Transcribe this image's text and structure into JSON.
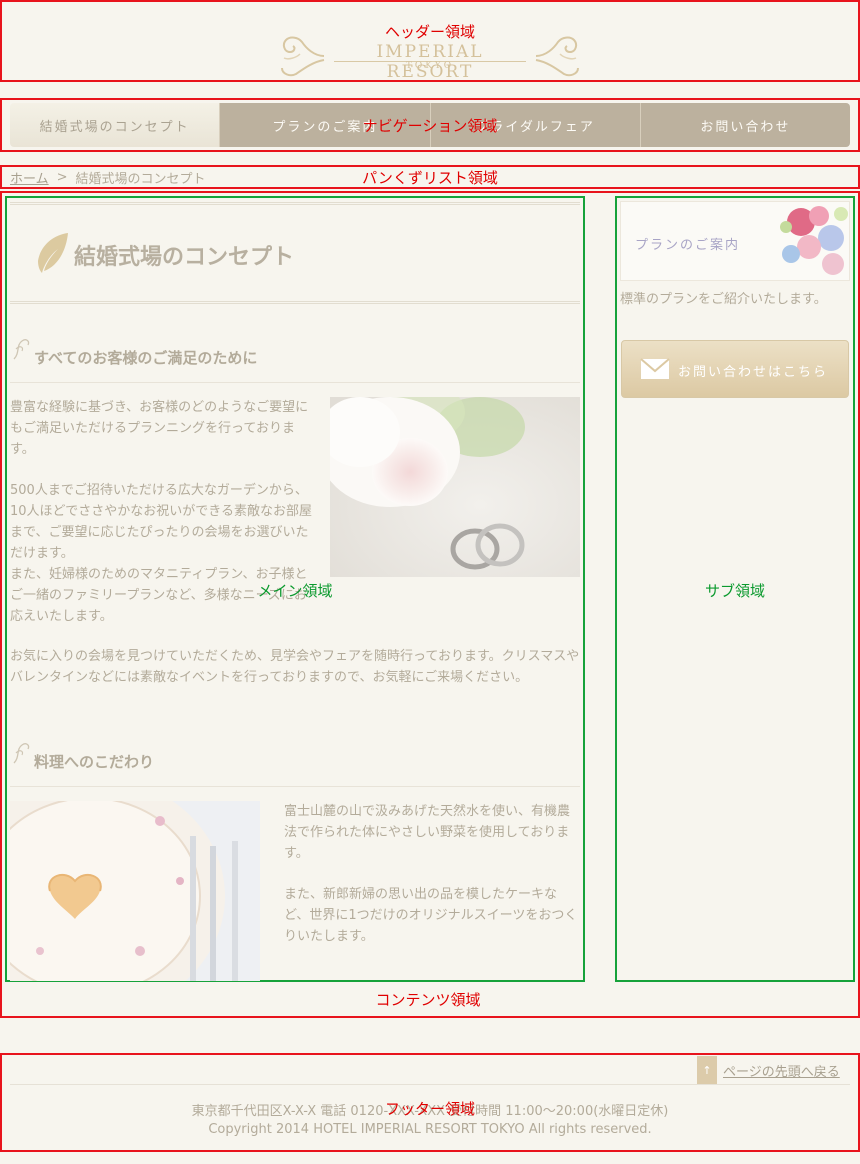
{
  "regions": {
    "header": "ヘッダー領域",
    "nav": "ナビゲーション領域",
    "breadcrumb": "パンくずリスト領域",
    "main": "メイン領域",
    "sub": "サブ領域",
    "contents": "コンテンツ領域",
    "footer": "フッター領域"
  },
  "header": {
    "logo_main": "IMPERIAL RESORT",
    "logo_sub": "TOKYO"
  },
  "nav": {
    "items": [
      {
        "label": "結婚式場のコンセプト",
        "active": true
      },
      {
        "label": "プランのご案内",
        "active": false
      },
      {
        "label": "ブライダルフェア",
        "active": false
      },
      {
        "label": "お問い合わせ",
        "active": false
      }
    ]
  },
  "breadcrumb": {
    "home": "ホーム",
    "separator": ">",
    "current": "結婚式場のコンセプト"
  },
  "main": {
    "page_title": "結婚式場のコンセプト",
    "section1": {
      "title": "すべてのお客様のご満足のために",
      "para1": "豊富な経験に基づき、お客様のどのようなご要望にもご満足いただけるプランニングを行っております。",
      "para2": "500人までご招待いただける広大なガーデンから、10人ほどでささやかなお祝いができる素敵なお部屋まで、ご要望に応じたぴったりの会場をお選びいただけます。",
      "para3": "また、妊婦様のためのマタニティプラン、お子様とご一緒のファミリープランなど、多様なニーズにお応えいたします。",
      "para4": "お気に入りの会場を見つけていただくため、見学会やフェアを随時行っております。クリスマスやバレンタインなどには素敵なイベントを行っておりますので、お気軽にご来場ください。"
    },
    "section2": {
      "title": "料理へのこだわり",
      "para1": "富士山麓の山で汲みあげた天然水を使い、有機農法で作られた体にやさしい野菜を使用しております。",
      "para2": "また、新郎新婦の思い出の品を模したケーキなど、世界に1つだけのオリジナルスイーツをおつくりいたします。"
    }
  },
  "sub": {
    "plan_banner": "プランのご案内",
    "plan_desc": "標準のプランをご紹介いたします。",
    "contact_button": "お問い合わせはこちら"
  },
  "footer": {
    "pagetop_arrow": "↑",
    "pagetop": "ページの先頭へ戻る",
    "address": "東京都千代田区X-X-X 電話 0120-XXX-XXX 受付時間 11:00～20:00(水曜日定休)",
    "copyright": "Copyright 2014 HOTEL IMPERIAL RESORT TOKYO All rights reserved."
  },
  "colors": {
    "background": "#f7f5ee",
    "text": "#b3ab9a",
    "nav": "#bcb19e",
    "region_red": "#e8141c",
    "region_green": "#16a23a"
  }
}
